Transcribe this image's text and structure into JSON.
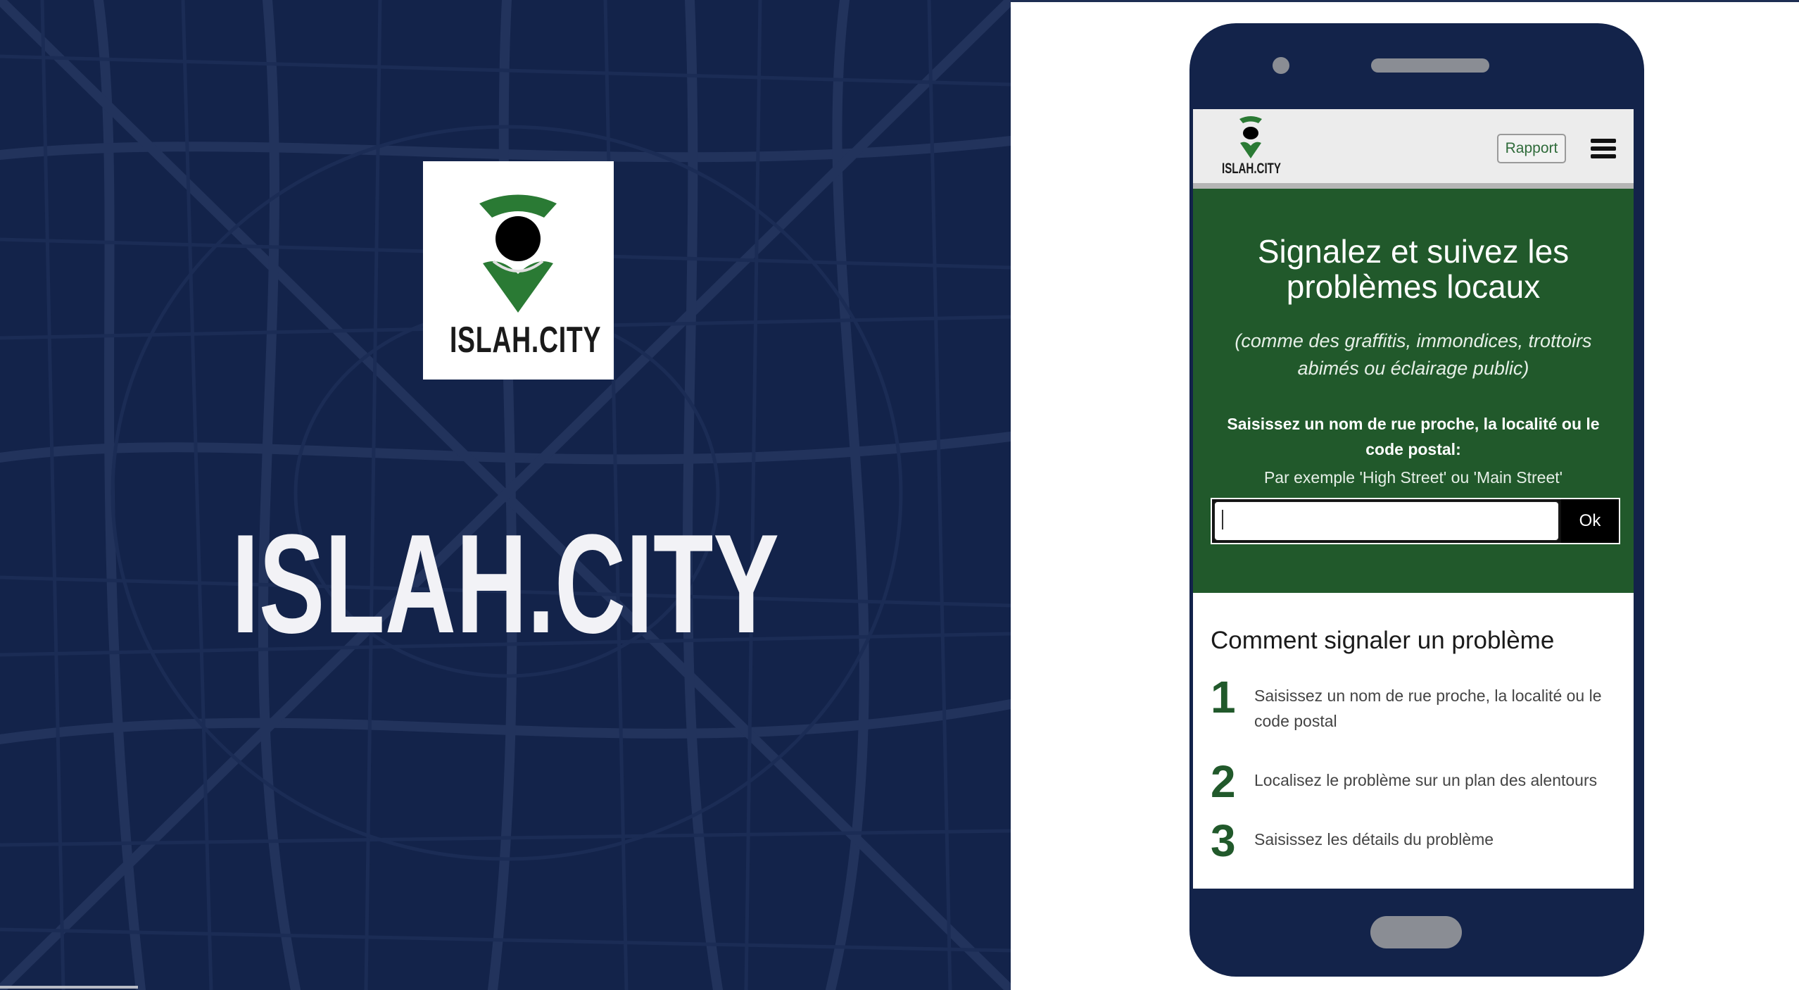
{
  "brand": {
    "logo_text": "ISLAH.CITY",
    "big_title": "ISLAH.CITY",
    "colors": {
      "navy": "#13234a",
      "green": "#21592b",
      "white": "#ffffff"
    }
  },
  "mobile": {
    "header": {
      "logo_text": "ISLAH.CITY",
      "report_button": "Rapport",
      "menu_icon": "hamburger-icon"
    },
    "hero": {
      "title": "Signalez et suivez les problèmes locaux",
      "subtitle": "(comme des graffitis, immondices, trottoirs abimés ou éclairage public)",
      "search_label": "Saisissez un nom de rue proche, la localité ou le code postal:",
      "example": "Par exemple 'High Street' ou 'Main Street'",
      "input_value": "",
      "ok_button": "Ok"
    },
    "howto": {
      "title": "Comment signaler un problème",
      "steps": [
        {
          "num": "1",
          "text": "Saisissez un nom de rue proche, la localité ou le code postal"
        },
        {
          "num": "2",
          "text": "Localisez le problème sur un plan des alentours"
        },
        {
          "num": "3",
          "text": "Saisissez les détails du problème"
        }
      ]
    }
  }
}
